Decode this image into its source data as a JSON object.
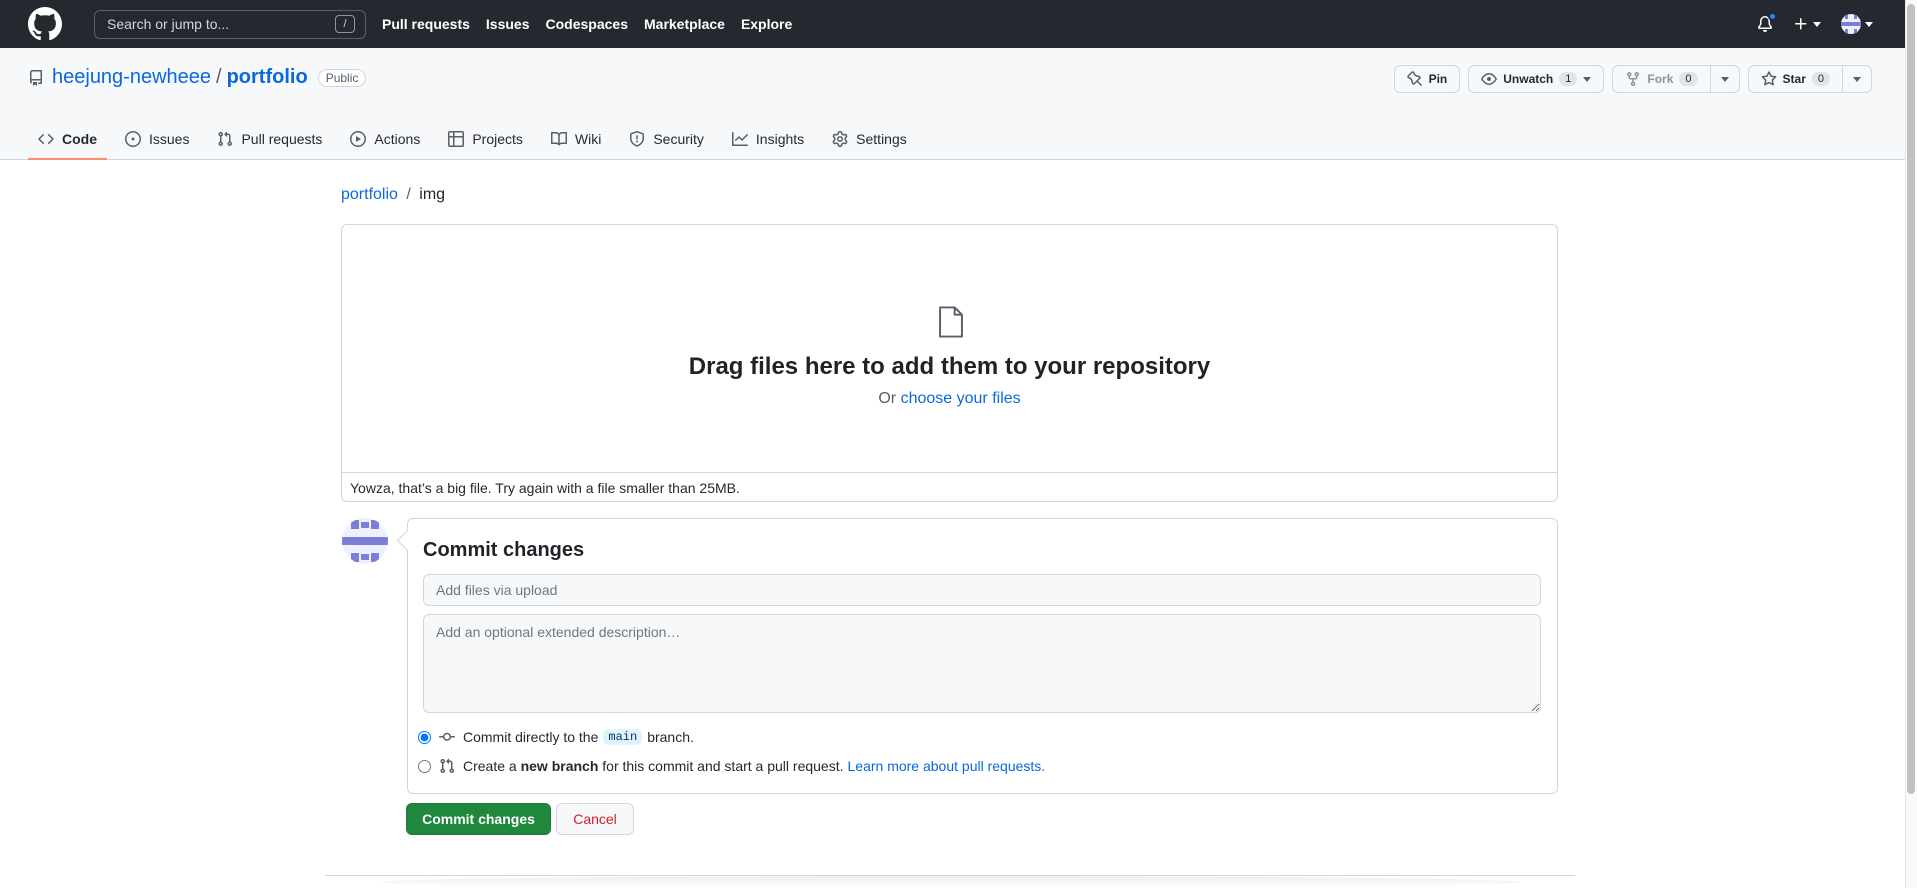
{
  "header": {
    "search_placeholder": "Search or jump to...",
    "search_shortcut": "/",
    "nav": [
      "Pull requests",
      "Issues",
      "Codespaces",
      "Marketplace",
      "Explore"
    ]
  },
  "repo": {
    "owner": "heejung-newheee",
    "separator": "/",
    "name": "portfolio",
    "visibility": "Public",
    "pin_label": "Pin",
    "unwatch_label": "Unwatch",
    "watch_count": "1",
    "fork_label": "Fork",
    "fork_count": "0",
    "star_label": "Star",
    "star_count": "0"
  },
  "tabs": [
    {
      "label": "Code",
      "icon": "code-icon",
      "active": true
    },
    {
      "label": "Issues",
      "icon": "issue-icon"
    },
    {
      "label": "Pull requests",
      "icon": "pull-request-icon"
    },
    {
      "label": "Actions",
      "icon": "play-icon"
    },
    {
      "label": "Projects",
      "icon": "table-icon"
    },
    {
      "label": "Wiki",
      "icon": "book-icon"
    },
    {
      "label": "Security",
      "icon": "shield-icon"
    },
    {
      "label": "Insights",
      "icon": "graph-icon"
    },
    {
      "label": "Settings",
      "icon": "gear-icon"
    }
  ],
  "breadcrumb": {
    "root": "portfolio",
    "separator": "/",
    "current": "img"
  },
  "dropzone": {
    "title": "Drag files here to add them to your repository",
    "or_text": "Or",
    "choose_link": "choose your files",
    "error": "Yowza, that’s a big file. Try again with a file smaller than 25MB."
  },
  "commit": {
    "title": "Commit changes",
    "summary_placeholder": "Add files via upload",
    "description_placeholder": "Add an optional extended description…",
    "option_direct_prefix": "Commit directly to the",
    "branch_name": "main",
    "option_direct_suffix": "branch.",
    "option_new_prefix": "Create a",
    "option_new_bold": "new branch",
    "option_new_suffix": "for this commit and start a pull request.",
    "learn_more": "Learn more about pull requests.",
    "submit_label": "Commit changes",
    "cancel_label": "Cancel"
  },
  "colors": {
    "primary": "#1f883d",
    "link": "#0969da",
    "danger": "#cf222e",
    "header": "#24292f"
  }
}
